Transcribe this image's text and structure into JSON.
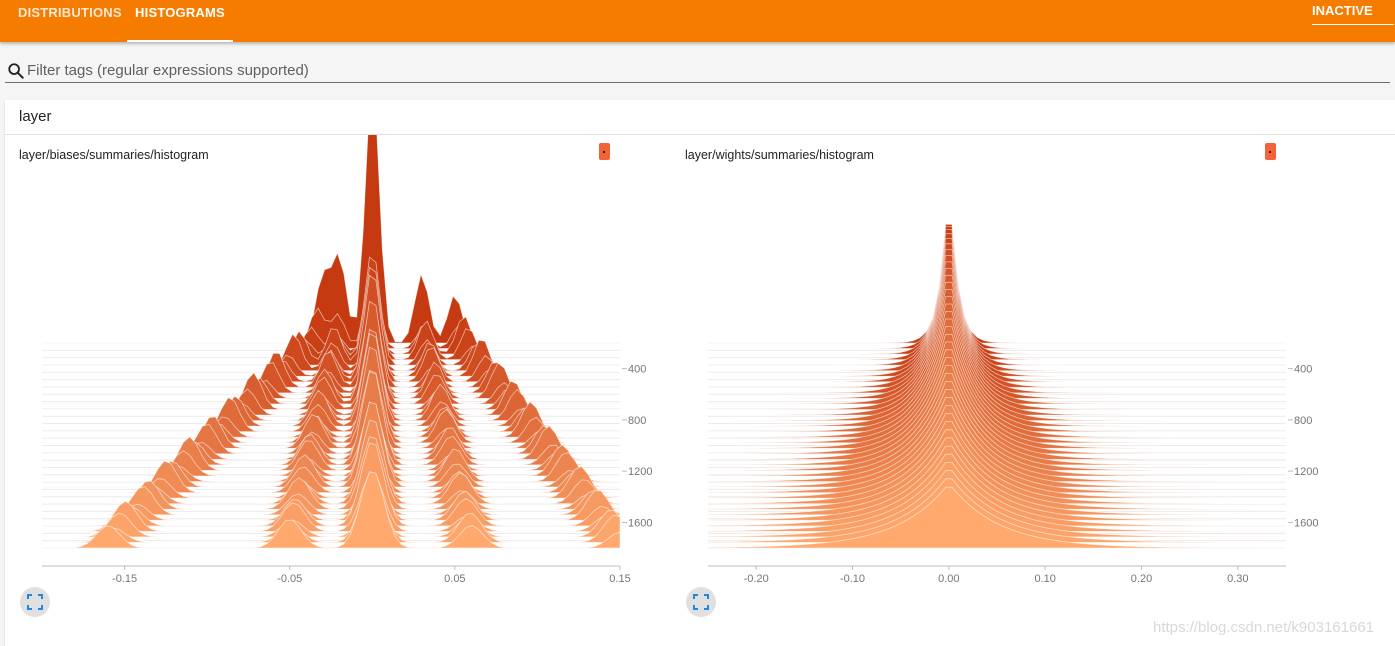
{
  "tabs": {
    "distributions": "DISTRIBUTIONS",
    "histograms": "HISTOGRAMS",
    "inactive": "INACTIVE"
  },
  "search": {
    "placeholder": "Filter tags (regular expressions supported)"
  },
  "group": {
    "name": "layer"
  },
  "watermark": "https://blog.csdn.net/k903161661",
  "colors": {
    "accent": "#f57c00",
    "hist_dark": "#c63a12",
    "hist_light": "#ffa96e"
  },
  "icons": {
    "search": "search-icon",
    "expand": "fullscreen-icon"
  },
  "chart_data": [
    {
      "type": "histogram",
      "title": "layer/biases/summaries/histogram",
      "x_ticks": [
        "-0.15",
        "-0.05",
        "0.05",
        "0.15"
      ],
      "x_tick_values": [
        -0.15,
        -0.05,
        0.05,
        0.15
      ],
      "xlim": [
        -0.2,
        0.15
      ],
      "y_ticks": [
        "400",
        "800",
        "1200",
        "1600"
      ],
      "y_tick_values": [
        400,
        800,
        1200,
        1600
      ],
      "steps": [
        200,
        1800
      ],
      "peak_centers_first_step": [
        -0.03,
        -0.02,
        0.0,
        0.03,
        0.05
      ],
      "peak_centers_last_step": [
        -0.16,
        -0.05,
        0.0,
        0.06,
        0.15
      ]
    },
    {
      "type": "histogram",
      "title": "layer/wights/summaries/histogram",
      "x_ticks": [
        "-0.20",
        "-0.10",
        "0.00",
        "0.10",
        "0.20",
        "0.30"
      ],
      "x_tick_values": [
        -0.2,
        -0.1,
        0.0,
        0.1,
        0.2,
        0.3
      ],
      "xlim": [
        -0.25,
        0.35
      ],
      "y_ticks": [
        "400",
        "800",
        "1200",
        "1600"
      ],
      "y_tick_values": [
        400,
        800,
        1200,
        1600
      ],
      "steps": [
        200,
        1800
      ],
      "center": 0.0
    }
  ]
}
